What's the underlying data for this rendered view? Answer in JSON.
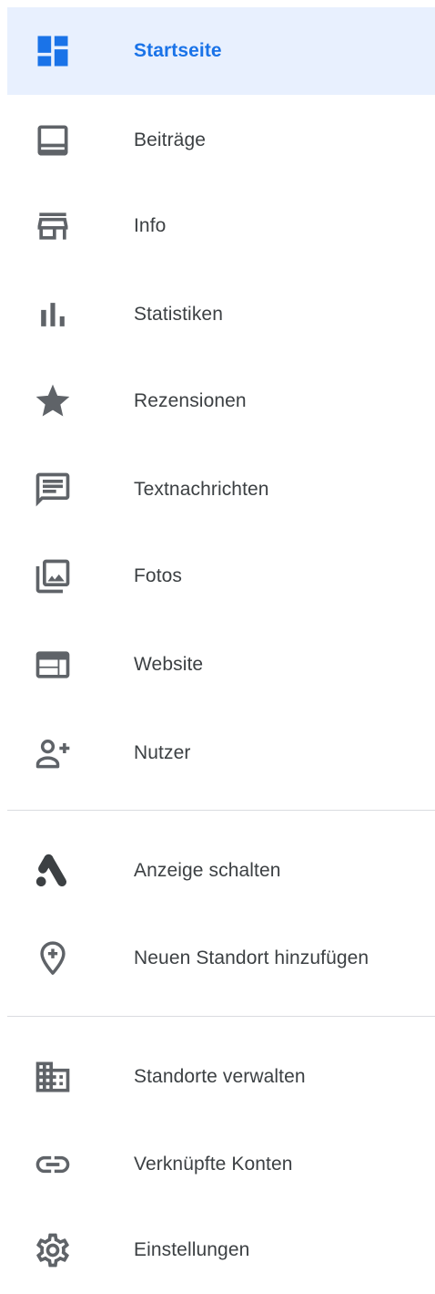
{
  "nav": {
    "items": [
      {
        "label": "Startseite",
        "icon": "dashboard-icon",
        "active": true
      },
      {
        "label": "Beiträge",
        "icon": "posts-icon"
      },
      {
        "label": "Info",
        "icon": "storefront-icon"
      },
      {
        "label": "Statistiken",
        "icon": "bar-chart-icon"
      },
      {
        "label": "Rezensionen",
        "icon": "star-icon"
      },
      {
        "label": "Textnachrichten",
        "icon": "message-icon"
      },
      {
        "label": "Fotos",
        "icon": "photo-library-icon"
      },
      {
        "label": "Website",
        "icon": "web-icon"
      },
      {
        "label": "Nutzer",
        "icon": "person-add-icon"
      }
    ],
    "secondary": [
      {
        "label": "Anzeige schalten",
        "icon": "google-ads-icon"
      },
      {
        "label": "Neuen Standort hinzufügen",
        "icon": "add-location-icon"
      }
    ],
    "tertiary": [
      {
        "label": "Standorte verwalten",
        "icon": "building-icon"
      },
      {
        "label": "Verknüpfte Konten",
        "icon": "link-icon"
      },
      {
        "label": "Einstellungen",
        "icon": "settings-icon"
      }
    ]
  },
  "colors": {
    "accent": "#1a73e8",
    "active_background": "#e8f0fe",
    "icon": "#5f6368",
    "text": "#3c4043",
    "divider": "#dadce0"
  }
}
